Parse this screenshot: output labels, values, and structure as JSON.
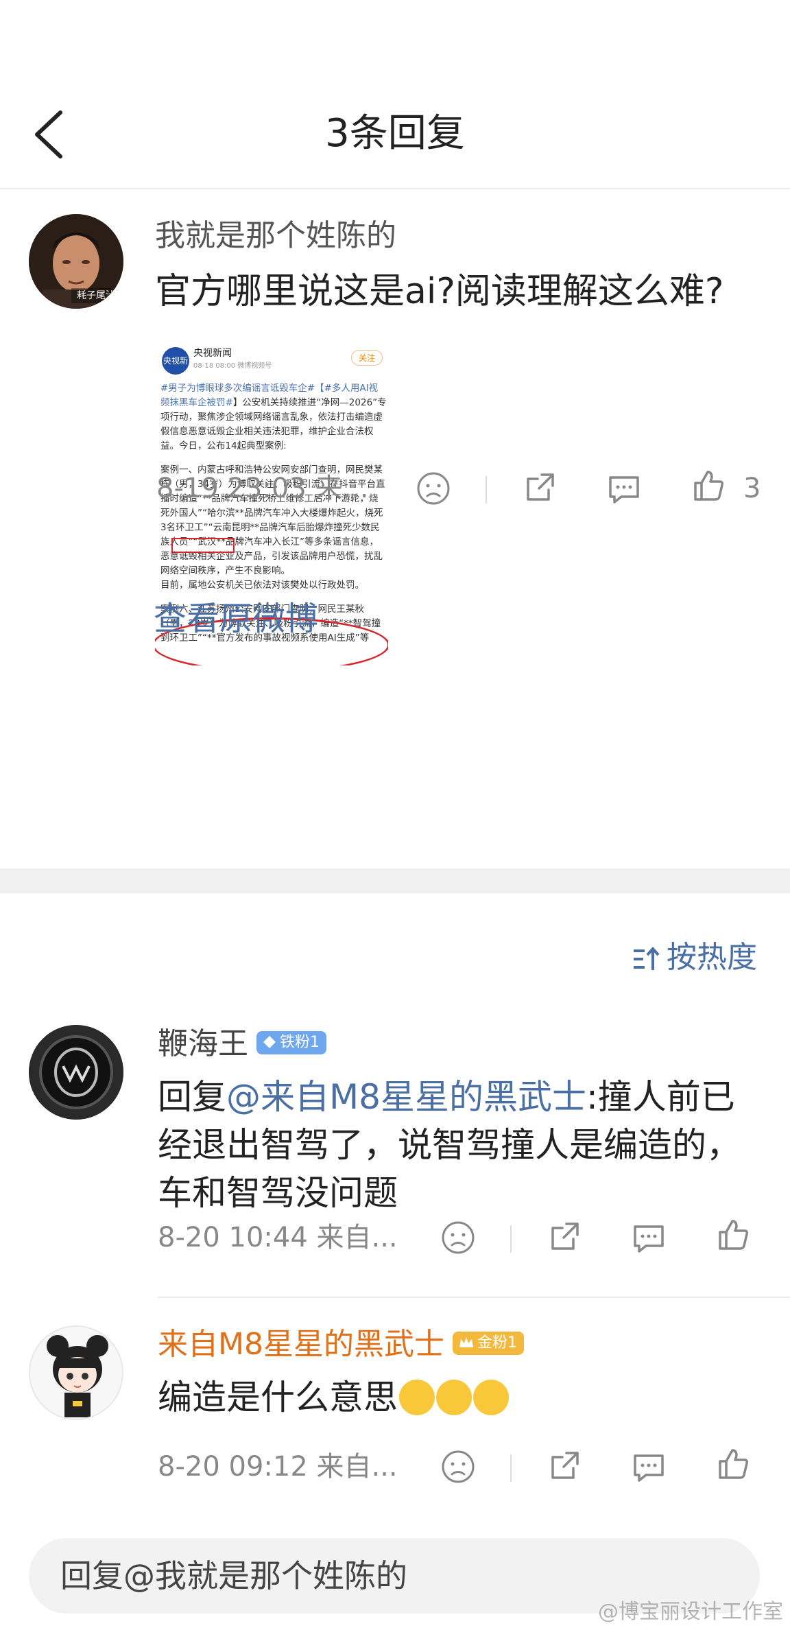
{
  "header": {
    "title": "3条回复"
  },
  "main_comment": {
    "username": "我就是那个姓陈的",
    "avatar_caption": "耗子尾汁",
    "text": "官方哪里说这是ai?阅读理解这么难?",
    "image": {
      "source": "央视新闻",
      "logo_text": "央视新闻",
      "time": "08-18 08:00  微博视频号",
      "follow": "关注",
      "para1_tag": "#男子为博眼球多次编谣言诋毁车企#",
      "para1_tag2": "【#多人用AI视频抹黑车企被罚#",
      "para1_rest": "】公安机关持续推进“净网—2026”专项行动，聚焦涉企领域网络谣言乱象，依法打击编造虚假信息恶意诋毁企业相关违法犯罪，维护企业合法权益。今日，公布14起典型案例:",
      "para2": "案例一、内蒙古呼和浩特公安网安部门查明，网民樊某栋（男，34岁）为博取关注、吸粉引流，在抖音平台直播时编造“**品牌汽车撞死桥上维修工后冲下游轮，烧死外国人”“哈尔滨**品牌汽车冲入大楼爆炸起火，烧死3名环卫工”“云南昆明**品牌汽车后胎爆炸撞死少数民族人员”“武汉**品牌汽车冲入长江”等多条谣言信息，恶意诋毁相关企业及产品，引发该品牌用户恐慌，扰乱网络空间秩序，产生不良影响。",
      "para3": "目前，属地公安机关已依法对该樊处以行政处罚。",
      "para4": "案例六、江苏扬州公安网安部门查明，网民王某秋（男，28岁）为博取关注、吸粉引流，编造“**智驾撞到环卫工”“**官方发布的事故视频系使用AI生成”等"
    },
    "meta_time": "8-19 23:03  来...",
    "like_count": "3",
    "view_original": "查看原微博"
  },
  "sort": {
    "label": "按热度"
  },
  "replies": [
    {
      "username": "鞭海王",
      "badge": "铁粉1",
      "text_prefix": "回复",
      "mention": "@来自M8星星的黑武士",
      "text_rest": ":撞人前已经退出智驾了，说智驾撞人是编造的，车和智驾没问题",
      "meta_time": "8-20 10:44  来自..."
    },
    {
      "username": "来自M8星星的黑武士",
      "badge": "金粉1",
      "text": "编造是什么意思",
      "meta_time": "8-20 09:12  来自..."
    }
  ],
  "reply_input": {
    "placeholder": "回复@我就是那个姓陈的"
  },
  "watermark": "@博宝丽设计工作室",
  "colors": {
    "link": "#4a6fa5",
    "username_orange": "#e0701a",
    "badge_iron": "#6fa7ee",
    "badge_gold": "#f3b93d"
  }
}
